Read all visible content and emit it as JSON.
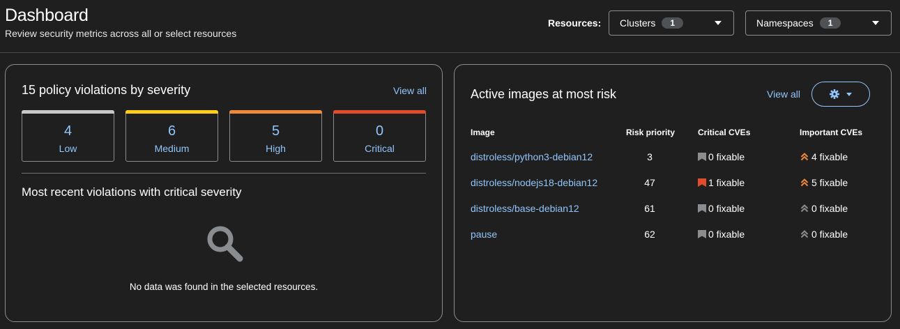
{
  "header": {
    "title": "Dashboard",
    "subtitle": "Review security metrics across all or select resources",
    "resources_label": "Resources:",
    "clusters": {
      "label": "Clusters",
      "count": "1"
    },
    "namespaces": {
      "label": "Namespaces",
      "count": "1"
    }
  },
  "violations_card": {
    "title": "15 policy violations by severity",
    "view_all": "View all",
    "tiles": [
      {
        "count": "4",
        "label": "Low",
        "color": "#c7c7c7"
      },
      {
        "count": "6",
        "label": "Medium",
        "color": "#ffcc17"
      },
      {
        "count": "5",
        "label": "High",
        "color": "#f0883a"
      },
      {
        "count": "0",
        "label": "Critical",
        "color": "#e24b2c"
      }
    ],
    "recent_title": "Most recent violations with critical severity",
    "empty_icon": "search-icon",
    "empty_text": "No data was found in the selected resources."
  },
  "images_card": {
    "title": "Active images at most risk",
    "view_all": "View all",
    "settings_icon": "gear-icon",
    "columns": [
      "Image",
      "Risk priority",
      "Critical CVEs",
      "Important CVEs"
    ],
    "rows": [
      {
        "image": "distroless/python3-debian12",
        "risk": "3",
        "critical": "0 fixable",
        "critical_active": false,
        "important": "4 fixable",
        "important_active": true
      },
      {
        "image": "distroless/nodejs18-debian12",
        "risk": "47",
        "critical": "1 fixable",
        "critical_active": true,
        "important": "5 fixable",
        "important_active": true
      },
      {
        "image": "distroless/base-debian12",
        "risk": "61",
        "critical": "0 fixable",
        "critical_active": false,
        "important": "0 fixable",
        "important_active": false
      },
      {
        "image": "pause",
        "risk": "62",
        "critical": "0 fixable",
        "critical_active": false,
        "important": "0 fixable",
        "important_active": false
      }
    ],
    "colors": {
      "critical_active": "#e24b2c",
      "important_active": "#f0883a",
      "inactive": "#8a8d90"
    }
  }
}
